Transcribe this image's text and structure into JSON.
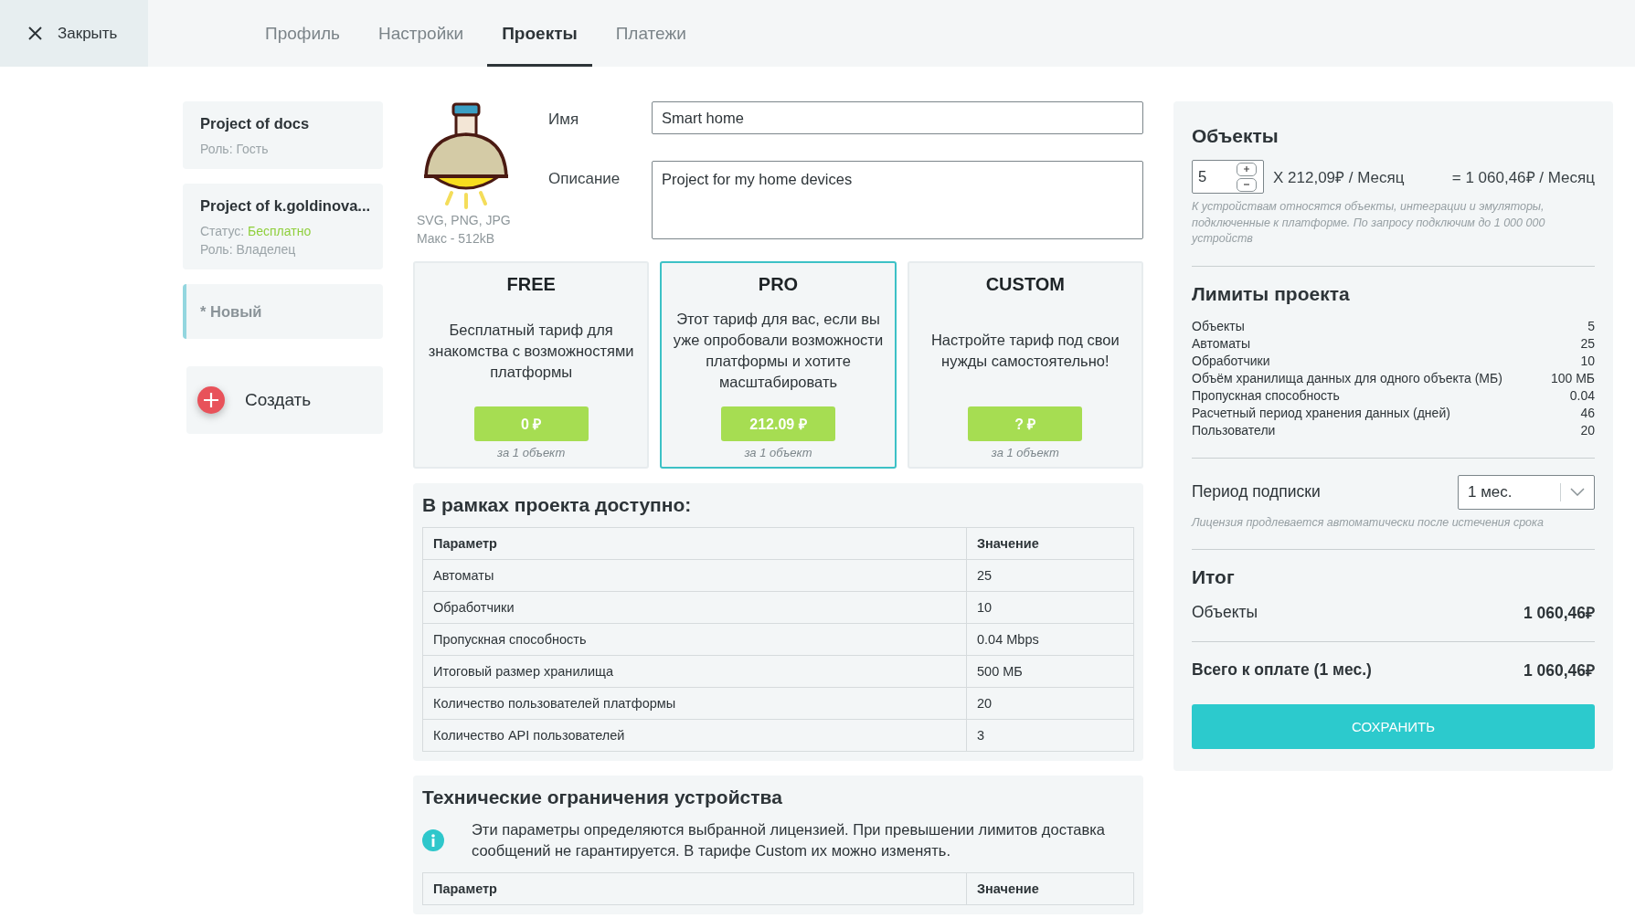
{
  "close_button": {
    "label": "Закрыть"
  },
  "tabs": [
    {
      "label": "Профиль",
      "selected": false
    },
    {
      "label": "Настройки",
      "selected": false
    },
    {
      "label": "Проекты",
      "selected": true
    },
    {
      "label": "Платежи",
      "selected": false
    }
  ],
  "projects": [
    {
      "title": "Project of docs",
      "role": "Роль: Гость",
      "selected": false
    },
    {
      "title": "Project of k.goldinova...",
      "status_label": "Статус:",
      "status_value": "Бесплатно",
      "role": "Роль: Владелец",
      "selected": false
    },
    {
      "title": "* Новый",
      "selected": true
    }
  ],
  "create_button": {
    "label": "Создать"
  },
  "image_upload": {
    "formats": "SVG, PNG, JPG",
    "max_size": "Макс - 512kB"
  },
  "fields": [
    {
      "kind": "input",
      "label": "Имя",
      "value": "Smart home"
    },
    {
      "kind": "textarea",
      "label": "Описание",
      "value": "Project for my home devices"
    }
  ],
  "plans": [
    {
      "name": "FREE",
      "description": "Бесплатный тариф для знакомства с возможностями платформы",
      "price": "0 ₽",
      "unit": "за 1 объект",
      "selected": false
    },
    {
      "name": "PRO",
      "description": "Этот тариф для вас, если вы уже опробовали возможности платформы и хотите масштабировать",
      "price": "212.09 ₽",
      "unit": "за 1 объект",
      "selected": true
    },
    {
      "name": "CUSTOM",
      "description": "Настройте тариф под свои нужды самостоятельно!",
      "price": "? ₽",
      "unit": "за 1 объект",
      "selected": false
    }
  ],
  "available": {
    "title": "В рамках проекта доступно:",
    "columns": [
      "Параметр",
      "Значение"
    ],
    "rows": [
      [
        "Автоматы",
        "25"
      ],
      [
        "Обработчики",
        "10"
      ],
      [
        "Пропускная способность",
        "0.04 Mbps"
      ],
      [
        "Итоговый размер хранилища",
        "500 МБ"
      ],
      [
        "Количество пользователей платформы",
        "20"
      ],
      [
        "Количество API пользователей",
        "3"
      ]
    ]
  },
  "tech_limits": {
    "title": "Технические ограничения устройства",
    "info": "Эти параметры определяются выбранной лицензией. При превышении лимитов доставка сообщений не гарантируется. В тарифе Custom их можно изменять.",
    "columns": [
      "Параметр",
      "Значение"
    ]
  },
  "summary": {
    "objects": {
      "title": "Объекты",
      "quantity": "5",
      "price": "X 212,09₽ / Месяц",
      "total": "= 1 060,46₽ / Месяц",
      "note": "К устройствам относятся объекты, интеграции и эмуляторы, подключенные к платформе. По запросу подключим до 1 000 000 устройств"
    },
    "limits": {
      "title": "Лимиты проекта",
      "rows": [
        {
          "label": "Объекты",
          "value": "5"
        },
        {
          "label": "Автоматы",
          "value": "25"
        },
        {
          "label": "Обработчики",
          "value": "10"
        },
        {
          "label": "Объём хранилища данных для одного объекта (МБ)",
          "value": "100 МБ"
        },
        {
          "label": "Пропускная способность",
          "value": "0.04"
        },
        {
          "label": "Расчетный период хранения данных (дней)",
          "value": "46"
        },
        {
          "label": "Пользователи",
          "value": "20"
        }
      ]
    },
    "period": {
      "label": "Период подписки",
      "value": "1 мес.",
      "note": "Лицензия продлевается автоматически после истечения срока"
    },
    "total": {
      "title": "Итог",
      "rows": [
        {
          "label": "Объекты",
          "value": "1 060,46₽"
        }
      ],
      "grand_label": "Всего к оплате (1 мес.)",
      "grand_value": "1 060,46₽"
    },
    "save_button": {
      "label": "СОХРАНИТЬ"
    }
  }
}
